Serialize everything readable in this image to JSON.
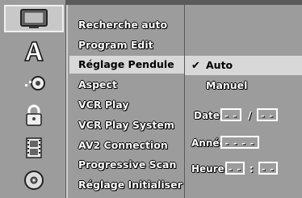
{
  "menu": {
    "items": [
      "Recherche auto",
      "Program Edit",
      "Réglage Pendule",
      "Aspect",
      "VCR Play",
      "VCR Play System",
      "AV2 Connection",
      "Progressive Scan",
      "Réglage Initialiser"
    ],
    "selected_index": 2
  },
  "options": {
    "auto_label": "Auto",
    "manuel_label": "Manuel",
    "selected": "Auto",
    "check_glyph": "✔"
  },
  "clock": {
    "date_label": "Date",
    "date_day": "- -",
    "date_sep": "/",
    "date_month": "- -",
    "year_label": "Année",
    "year_value": "- - - -",
    "hour_label": "Heure",
    "hour_hh": "- -",
    "hour_sep": ":",
    "hour_mm": "- -"
  },
  "icons": [
    "tv-icon",
    "font-icon",
    "audio-icon",
    "lock-icon",
    "film-icon",
    "disc-icon"
  ],
  "colors": {
    "panel": "#9c9c9c",
    "highlight": "#d8d8d8",
    "icon_selected": "#c8c8c8"
  }
}
